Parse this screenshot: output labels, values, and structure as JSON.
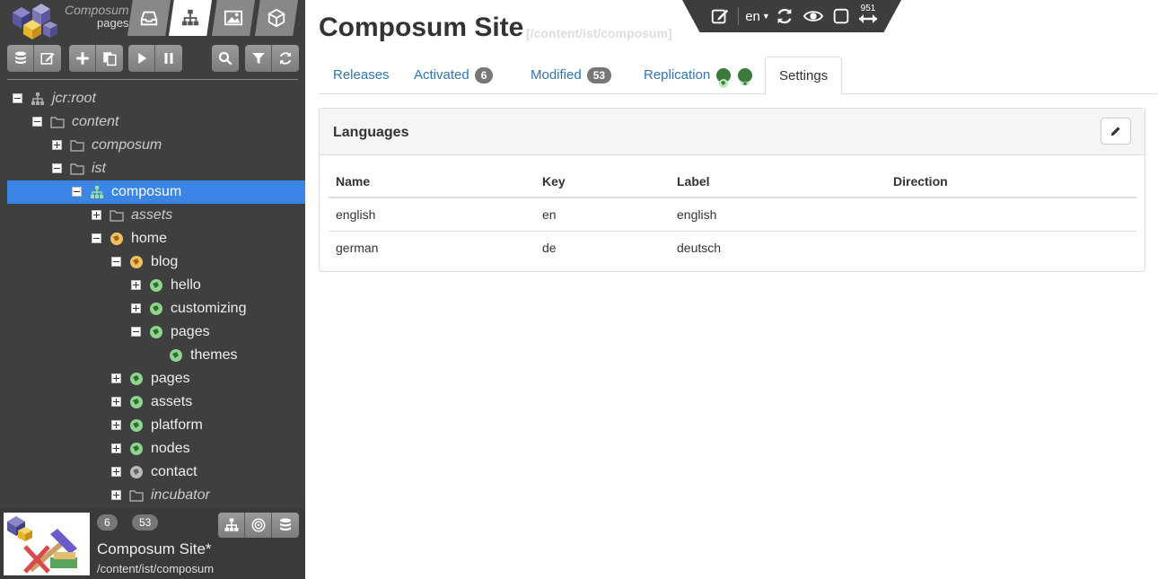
{
  "app": {
    "brand_name": "Composum",
    "brand_sub": "pages"
  },
  "sidebar": {
    "nav_tabs": [
      {
        "icon": "inbox-icon"
      },
      {
        "icon": "sitemap-icon"
      },
      {
        "icon": "image-icon"
      },
      {
        "icon": "cube-icon"
      }
    ],
    "tree": [
      {
        "label": "jcr:root",
        "italic": true,
        "toggle": "minus",
        "icon": "sitemap"
      },
      {
        "label": "content",
        "italic": true,
        "toggle": "minus",
        "icon": "folder"
      },
      {
        "label": "composum",
        "italic": true,
        "toggle": "plus",
        "icon": "folder"
      },
      {
        "label": "ist",
        "italic": true,
        "toggle": "minus",
        "icon": "folder"
      },
      {
        "label": "composum",
        "italic": false,
        "toggle": "minus",
        "icon": "sitemap",
        "selected": true
      },
      {
        "label": "assets",
        "italic": true,
        "toggle": "plus",
        "icon": "folder"
      },
      {
        "label": "home",
        "italic": false,
        "toggle": "minus",
        "icon": "globe-orange"
      },
      {
        "label": "blog",
        "italic": false,
        "toggle": "minus",
        "icon": "globe-orange"
      },
      {
        "label": "hello",
        "italic": false,
        "toggle": "plus",
        "icon": "globe-green"
      },
      {
        "label": "customizing",
        "italic": false,
        "toggle": "plus",
        "icon": "globe-green"
      },
      {
        "label": "pages",
        "italic": false,
        "toggle": "minus",
        "icon": "globe-green"
      },
      {
        "label": "themes",
        "italic": false,
        "toggle": "none",
        "icon": "globe-green"
      },
      {
        "label": "pages",
        "italic": false,
        "toggle": "plus",
        "icon": "globe-green"
      },
      {
        "label": "assets",
        "italic": false,
        "toggle": "plus",
        "icon": "globe-green"
      },
      {
        "label": "platform",
        "italic": false,
        "toggle": "plus",
        "icon": "globe-green"
      },
      {
        "label": "nodes",
        "italic": false,
        "toggle": "plus",
        "icon": "globe-green"
      },
      {
        "label": "contact",
        "italic": false,
        "toggle": "plus",
        "icon": "globe-gray"
      },
      {
        "label": "incubator",
        "italic": true,
        "toggle": "plus",
        "icon": "folder"
      }
    ],
    "bottom": {
      "activated_count": "6",
      "modified_count": "53",
      "site_title": "Composum Site*",
      "site_path": "/content/ist/composum"
    }
  },
  "main": {
    "title": "Composum Site",
    "title_path": "[/content/ist/composum]",
    "floatbar": {
      "language": "en",
      "width_value": "951"
    },
    "tabs": {
      "releases": "Releases",
      "activated": "Activated",
      "activated_count": "6",
      "modified": "Modified",
      "modified_count": "53",
      "replication": "Replication",
      "settings": "Settings"
    },
    "panel": {
      "title": "Languages",
      "columns": [
        "Name",
        "Key",
        "Label",
        "Direction"
      ],
      "rows": [
        [
          "english",
          "en",
          "english",
          ""
        ],
        [
          "german",
          "de",
          "deutsch",
          ""
        ]
      ]
    }
  }
}
